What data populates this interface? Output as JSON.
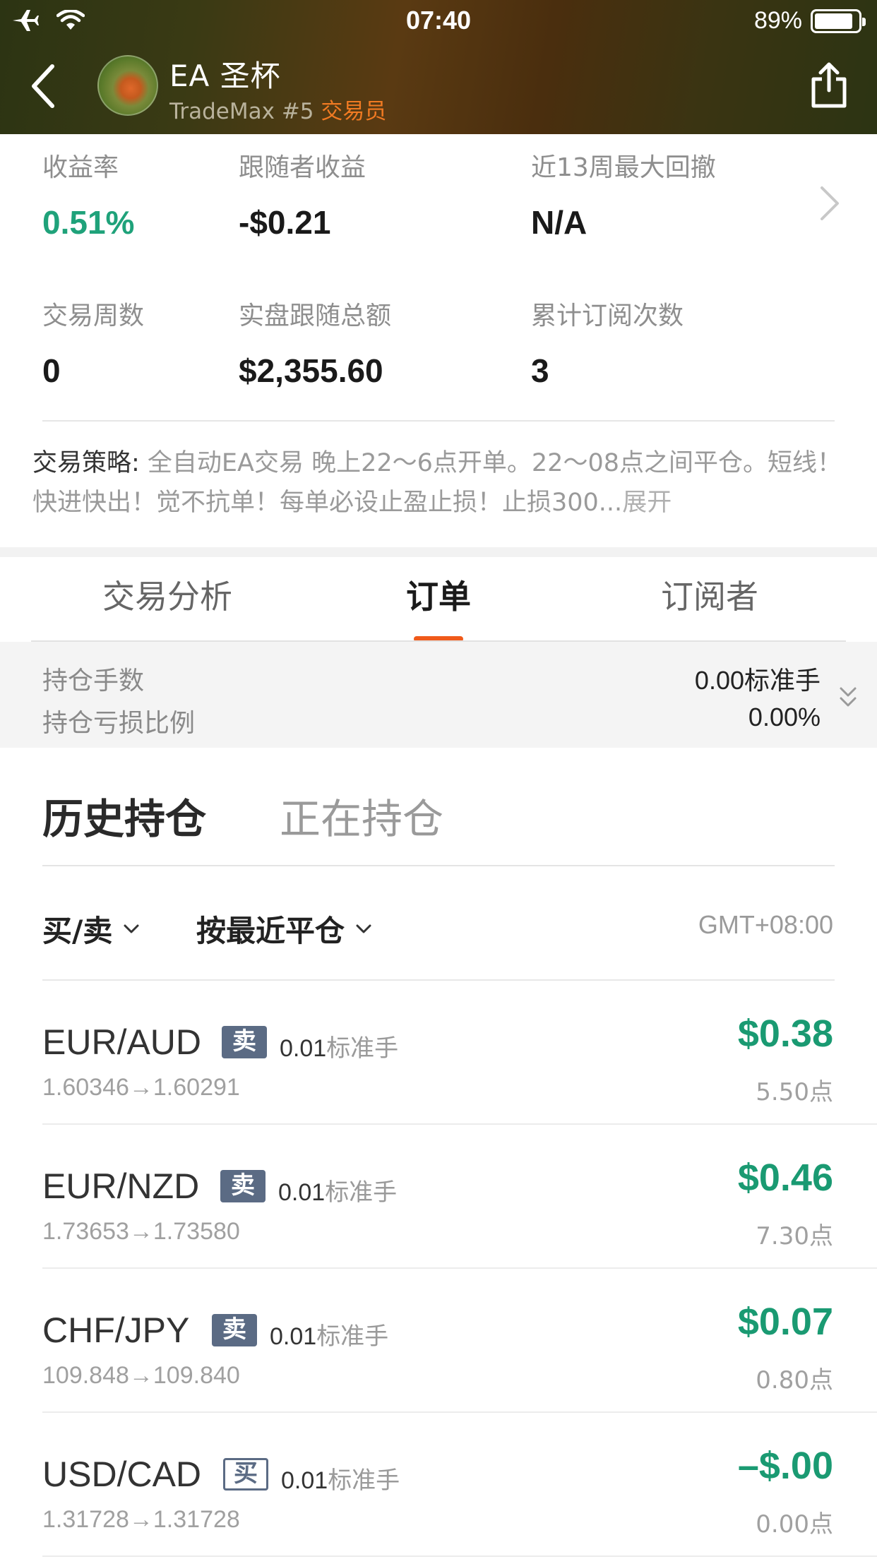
{
  "status_bar": {
    "time": "07:40",
    "battery": "89%",
    "battery_level": 0.89
  },
  "header": {
    "name": "EA  圣杯",
    "sub_prefix": "TradeMax #5 ",
    "sub_role": "交易员",
    "role_color": "#f07a22"
  },
  "stats": {
    "return_label": "收益率",
    "return_value": "0.51%",
    "follower_label": "跟随者收益",
    "follower_value": "-$0.21",
    "drawdown_label": "近13周最大回撤",
    "drawdown_value": "N/A",
    "weeks_label": "交易周数",
    "weeks_value": "0",
    "live_label": "实盘跟随总额",
    "live_value": "$2,355.60",
    "subs_label": "累计订阅次数",
    "subs_value": "3"
  },
  "strategy": {
    "label": "交易策略: ",
    "text": "全自动EA交易 晚上22～6点开单。22～08点之间平仓。短线！快进快出！觉不抗单！每单必设止盈止损！止损300...",
    "expand": "展开"
  },
  "tabs": [
    {
      "label": "交易分析"
    },
    {
      "label": "订单"
    },
    {
      "label": "订阅者"
    }
  ],
  "active_tab": 1,
  "summary": {
    "lots_label": "持仓手数",
    "lots_value": "0.00标准手",
    "loss_label": "持仓亏损比例",
    "loss_value": "0.00%"
  },
  "subtabs": {
    "history": "历史持仓",
    "open": "正在持仓"
  },
  "filters": {
    "side": "买/卖",
    "sort": "按最近平仓",
    "timezone": "GMT+08:00"
  },
  "orders": [
    {
      "pair": "EUR/AUD",
      "side": "卖",
      "lots": "0.01",
      "unit": "标准手",
      "prices": "1.60346→1.60291",
      "profit": "$0.38",
      "points": "5.50点"
    },
    {
      "pair": "EUR/NZD",
      "side": "卖",
      "lots": "0.01",
      "unit": "标准手",
      "prices": "1.73653→1.73580",
      "profit": "$0.46",
      "points": "7.30点"
    },
    {
      "pair": "CHF/JPY",
      "side": "卖",
      "lots": "0.01",
      "unit": "标准手",
      "prices": "109.848→109.840",
      "profit": "$0.07",
      "points": "0.80点"
    },
    {
      "pair": "USD/CAD",
      "side": "买",
      "lots": "0.01",
      "unit": "标准手",
      "prices": "1.31728→1.31728",
      "profit": "–$.00",
      "points": "0.00点"
    }
  ],
  "colors": {
    "profit_green": "#1a9a72",
    "accent_orange": "#f05a1a",
    "sell_badge": "#5b6b84"
  }
}
